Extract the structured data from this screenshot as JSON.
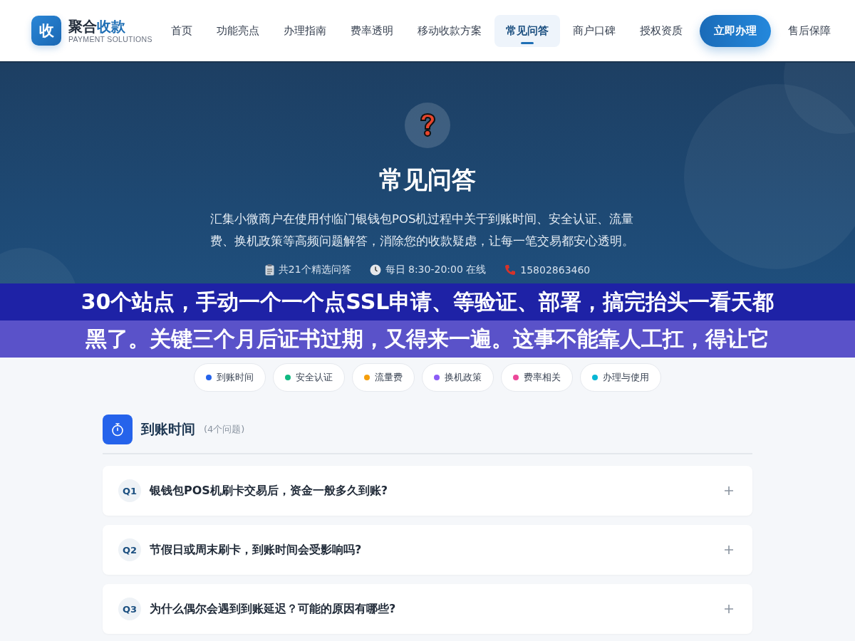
{
  "brand": {
    "logo": "收",
    "name_plain": "聚合",
    "name_accent": "收款",
    "tagline": "PAYMENT SOLUTIONS"
  },
  "nav": [
    {
      "label": "首页",
      "selected": false,
      "kind": "link"
    },
    {
      "label": "功能亮点",
      "selected": false,
      "kind": "link"
    },
    {
      "label": "办理指南",
      "selected": false,
      "kind": "link"
    },
    {
      "label": "费率透明",
      "selected": false,
      "kind": "link"
    },
    {
      "label": "移动收款方案",
      "selected": false,
      "kind": "link"
    },
    {
      "label": "常见问答",
      "selected": true,
      "kind": "link"
    },
    {
      "label": "商户口碑",
      "selected": false,
      "kind": "link"
    },
    {
      "label": "授权资质",
      "selected": false,
      "kind": "link"
    },
    {
      "label": "立即办理",
      "kind": "cta"
    },
    {
      "label": "售后保障",
      "selected": false,
      "kind": "link"
    }
  ],
  "hero": {
    "title": "常见问答",
    "description": "汇集小微商户在使用付临门银钱包POS机过程中关于到账时间、安全认证、流量费、换机政策等高频问题解答，消除您的收款疑虑，让每一笔交易都安心透明。",
    "meta": [
      {
        "kind": "list",
        "text": "共21个精选问答"
      },
      {
        "kind": "clock",
        "text": "每日 8:30-20:00 在线"
      },
      {
        "kind": "phone",
        "text": "15802863460"
      }
    ]
  },
  "overlay_caption": [
    "30个站点，手动一个一个点SSL申请、等验证、部署，搞完抬头一看天都",
    "黑了。关键三个月后证书过期，又得来一遍。这事不能靠人工扛，得让它"
  ],
  "categories": [
    {
      "label": "到账时间",
      "color": "#2563eb"
    },
    {
      "label": "安全认证",
      "color": "#10b981"
    },
    {
      "label": "流量费",
      "color": "#f59e0b"
    },
    {
      "label": "换机政策",
      "color": "#8b5cf6"
    },
    {
      "label": "费率相关",
      "color": "#ec4899"
    },
    {
      "label": "办理与使用",
      "color": "#06b6d4"
    }
  ],
  "section": {
    "title": "到账时间",
    "count": "(4个问题)",
    "questions": [
      {
        "number": "Q1",
        "text": "银钱包POS机刷卡交易后，资金一般多久到账?",
        "expanded": false
      },
      {
        "number": "Q2",
        "text": "节假日或周末刷卡，到账时间会受影响吗?",
        "expanded": false
      },
      {
        "number": "Q3",
        "text": "为什么偶尔会遇到到账延迟？可能的原因有哪些?",
        "expanded": false
      }
    ]
  }
}
